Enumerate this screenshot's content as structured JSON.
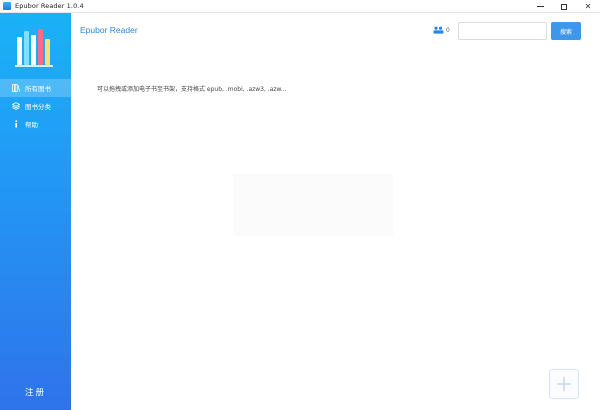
{
  "window": {
    "title": "Epubor Reader 1.0.4"
  },
  "sidebar": {
    "items": [
      {
        "label": "所有图书",
        "icon": "books-icon",
        "active": true
      },
      {
        "label": "图书分类",
        "icon": "layers-icon",
        "active": false
      },
      {
        "label": "帮助",
        "icon": "info-icon",
        "active": false
      }
    ],
    "register_label": "注册"
  },
  "header": {
    "brand": "Epubor Reader",
    "sync_count": "0",
    "search_placeholder": "",
    "search_button": "搜索"
  },
  "main": {
    "hint": "可以拖拽或添加电子书至书架，支持格式 epub, .mobi, .azw3, .azw..."
  },
  "colors": {
    "accent": "#3f97ec",
    "sidebar_top": "#1ab2f7",
    "sidebar_bottom": "#2f73ea",
    "brand_text": "#2a86e4"
  }
}
